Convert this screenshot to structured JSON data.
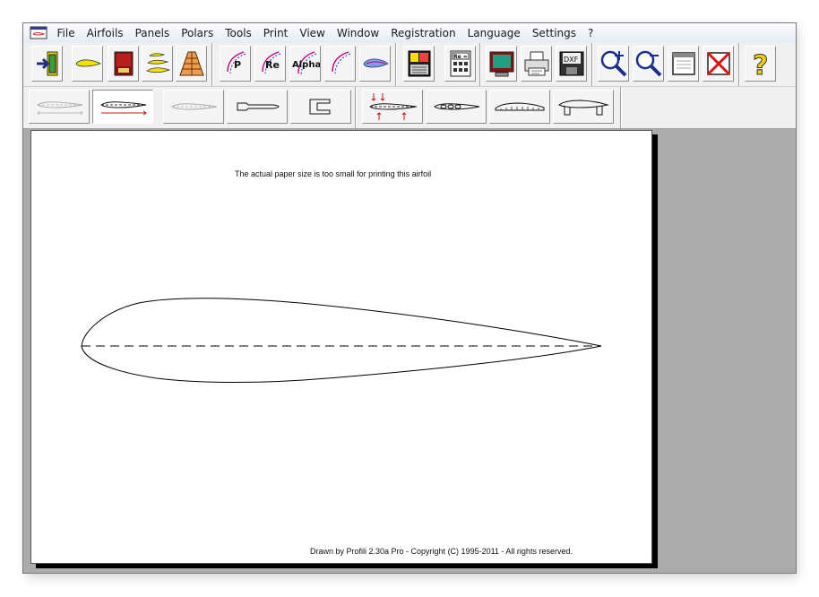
{
  "menu": {
    "items": [
      "File",
      "Airfoils",
      "Panels",
      "Polars",
      "Tools",
      "Print",
      "View",
      "Window",
      "Registration",
      "Language",
      "Settings",
      "?"
    ]
  },
  "toolbar_main": {
    "buttons": [
      {
        "name": "exit-icon"
      },
      {
        "name": "airfoil-icon"
      },
      {
        "name": "database-book-icon"
      },
      {
        "name": "airfoil-stack-icon"
      },
      {
        "name": "wing-panel-icon"
      },
      {
        "name": "polar-p-icon",
        "label": "P"
      },
      {
        "name": "polar-re-icon",
        "label": "Re"
      },
      {
        "name": "polar-alpha-icon",
        "label": "Alpha"
      },
      {
        "name": "polar-curve-icon"
      },
      {
        "name": "airfoil-pressure-icon"
      },
      {
        "name": "calculator-chart-icon"
      },
      {
        "name": "re-calculator-icon",
        "label": "Re ="
      },
      {
        "name": "monitor-icon"
      },
      {
        "name": "printer-icon"
      },
      {
        "name": "dxf-save-icon",
        "label": "DXF"
      },
      {
        "name": "zoom-in-icon"
      },
      {
        "name": "zoom-out-icon"
      },
      {
        "name": "window-icon"
      },
      {
        "name": "close-red-x-icon"
      },
      {
        "name": "help-question-icon",
        "label": "?"
      }
    ]
  },
  "toolbar_print": {
    "buttons": [
      {
        "name": "print-airfoil-grey-icon"
      },
      {
        "name": "print-airfoil-chord-icon"
      },
      {
        "name": "print-airfoil-light-icon"
      },
      {
        "name": "print-template-icon"
      },
      {
        "name": "print-notch-icon"
      },
      {
        "name": "print-spars-icon"
      },
      {
        "name": "print-holes-icon"
      },
      {
        "name": "print-ribs-icon"
      },
      {
        "name": "print-jig-icon"
      }
    ]
  },
  "paper": {
    "warning": "The actual paper size is too small for  printing  this airfoil",
    "footer": "Drawn by Profili 2.30a Pro - Copyright (C) 1995-2011 - All rights reserved."
  }
}
